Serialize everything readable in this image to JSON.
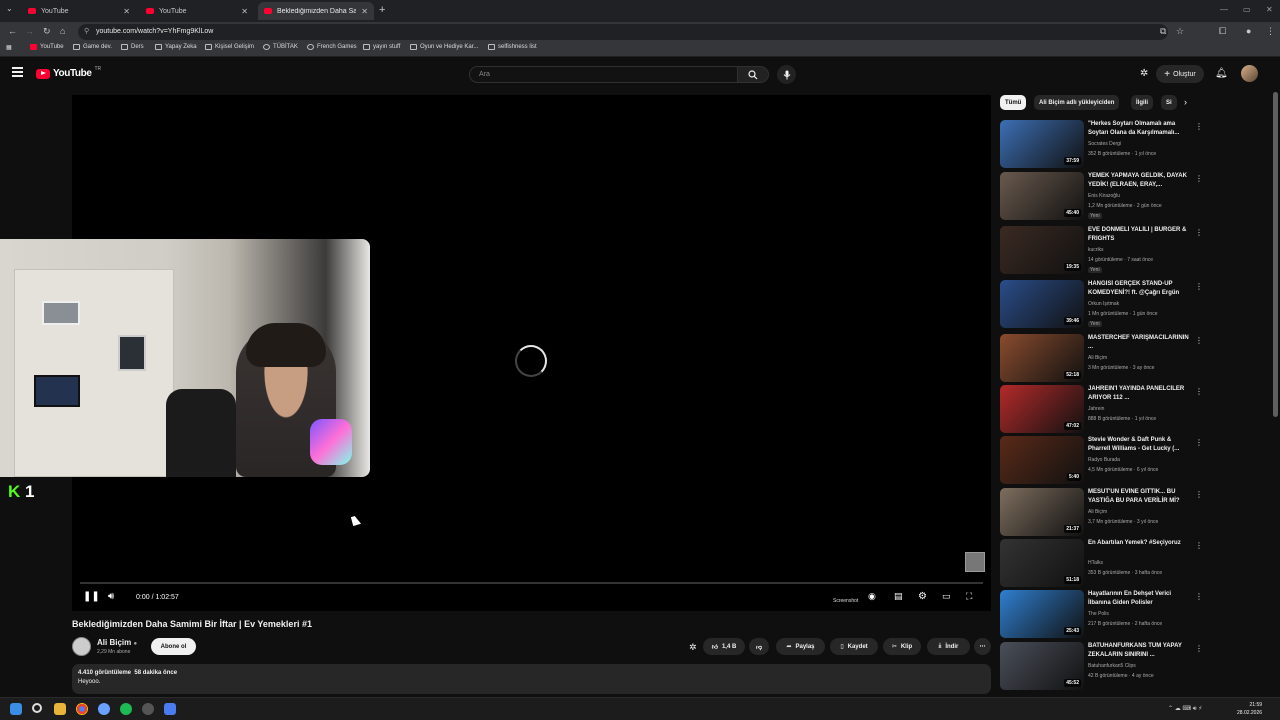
{
  "browser": {
    "tabs": [
      {
        "title": "YouTube",
        "active": false
      },
      {
        "title": "YouTube",
        "active": false
      },
      {
        "title": "Beklediğimizden Daha Samimi",
        "active": true
      }
    ],
    "url": "youtube.com/watch?v=YhFmg9KlLow",
    "bookmarks": [
      "YouTube",
      "Game dev.",
      "Ders",
      "Yapay Zeka",
      "Kişisel Gelişim",
      "TÜBİTAK",
      "French Games",
      "yayın stuff",
      "Oyun ve Hediye Kar...",
      "selfishness list"
    ]
  },
  "header": {
    "logo": "YouTube",
    "country_code": "TR",
    "search_placeholder": "Ara",
    "create_label": "Oluştur"
  },
  "player": {
    "time": "0:00 / 1:02:57",
    "screenshot_label": "Screenshot",
    "overlay_k": "K",
    "overlay_num": "1",
    "progress": 0.0
  },
  "video": {
    "title": "Beklediğimizden Daha Samimi Bir İftar | Ev Yemekleri #1",
    "channel": "Ali Biçim",
    "subscribers": "2,29 Mn abone",
    "subscribe_label": "Abone ol",
    "likes": "1,4 B",
    "share_label": "Paylaş",
    "save_label": "Kaydet",
    "clip_label": "Klip",
    "download_label": "İndir",
    "views": "4.410 görüntüleme",
    "age": "58 dakika önce",
    "description": "Heyooo."
  },
  "chips": [
    "Tümü",
    "Ali Biçim adlı yükleyiciden",
    "İlgili",
    "Si"
  ],
  "recommendations": [
    {
      "title": "\"Herkes Soytarı Olmamalı ama Soytarı Olana da Karşılmamalı...",
      "channel": "Socrates Dergi",
      "meta": "352 B görüntüleme · 1 yıl önce",
      "duration": "37:59",
      "badge": "",
      "color": "#3c6fb5"
    },
    {
      "title": "YEMEK YAPMAYA GELDİK, DAYAK YEDİK! (ELRAEN, ERAY,...",
      "channel": "Enis Kirazoğlu",
      "meta": "1,2 Mn görüntüleme · 2 gün önce",
      "duration": "45:40",
      "badge": "Yeni",
      "color": "#6a5a4e"
    },
    {
      "title": "EVE DÖNMELİ YALİLİ | BURGER & FRIGHTS",
      "channel": "kucriks",
      "meta": "14 görüntüleme · 7 saat önce",
      "duration": "19:35",
      "badge": "Yeni",
      "color": "#3b2a22"
    },
    {
      "title": "HANGİSİ GERÇEK STAND-UP KOMEDYENİ?! ft. @Çağrı Ergün",
      "channel": "Orkun Işıtmak",
      "meta": "1 Mn görüntüleme · 1 gün önce",
      "duration": "39:46",
      "badge": "Yeni",
      "color": "#2a4d8a"
    },
    {
      "title": "MASTERCHEF YARIŞMACILARININ ...",
      "channel": "Ali Biçim",
      "meta": "3 Mn görüntüleme · 3 ay önce",
      "duration": "52:18",
      "badge": "",
      "color": "#8a4c2e"
    },
    {
      "title": "JAHREIN'İ YAYINDA PANELCİLER ARIYOR 112 ...",
      "channel": "Jahrein",
      "meta": "888 B görüntüleme · 1 yıl önce",
      "duration": "47:02",
      "badge": "",
      "color": "#b42a2a"
    },
    {
      "title": "Stevie Wonder & Daft Punk & Pharrell Williams - Get Lucky (...",
      "channel": "Radyo Burada",
      "meta": "4,5 Mn görüntüleme · 6 yıl önce",
      "duration": "5:40",
      "badge": "",
      "color": "#5a2a18"
    },
    {
      "title": "MESUT'UN EVİNE GİTTİK... BU YASTIĞA BU PARA VERİLİR Mİ?",
      "channel": "Ali Biçim",
      "meta": "3,7 Mn görüntüleme · 3 yıl önce",
      "duration": "21:37",
      "badge": "",
      "color": "#7e6e5e"
    },
    {
      "title": "En Abartılan Yemek? #Seçiyoruz",
      "channel": "HTalks",
      "meta": "353 B görüntüleme · 3 hafta önce",
      "duration": "51:18",
      "badge": "",
      "color": "#333333"
    },
    {
      "title": "Hayatlarının En Dehşet Verici İlbanına Giden Polisler",
      "channel": "The Polis",
      "meta": "217 B görüntüleme · 2 hafta önce",
      "duration": "25:43",
      "badge": "",
      "color": "#2f7fd0"
    },
    {
      "title": "BATUHANFURKANS TÜM YAPAY ZEKALARIN SINIRINI ...",
      "channel": "Batuhanfurkan5 Clips",
      "meta": "42 B görüntüleme · 4 ay önce",
      "duration": "45:52",
      "badge": "",
      "color": "#4a4f5a"
    }
  ],
  "taskbar": {
    "time": "21:59",
    "date": "28.02.2026"
  },
  "colors": {
    "background": "#0f0f0f",
    "youtube_red": "#ff0033",
    "kick_green": "#53fc18"
  }
}
